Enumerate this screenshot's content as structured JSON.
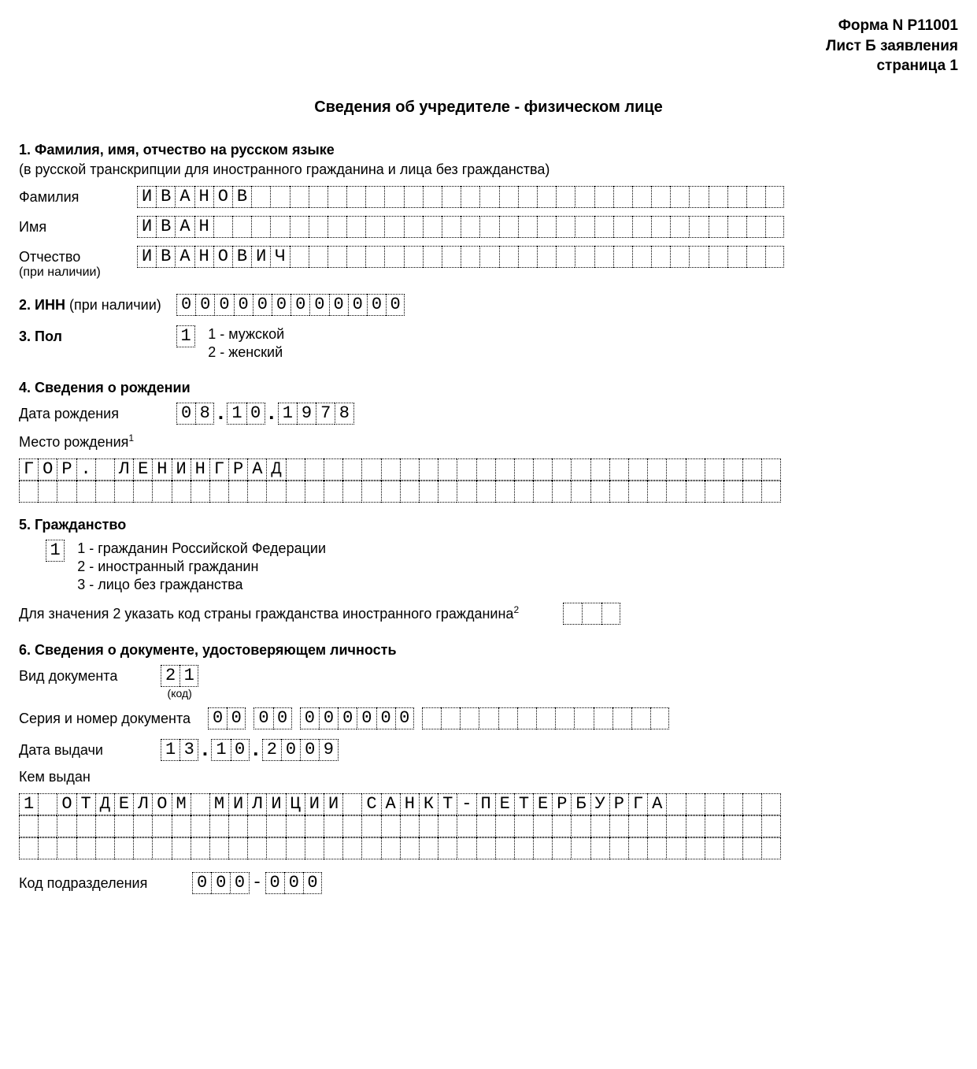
{
  "header": {
    "form": "Форма N Р11001",
    "sheet": "Лист Б заявления",
    "page": "страница 1"
  },
  "title": "Сведения об учредителе - физическом лице",
  "s1": {
    "head": "1. Фамилия, имя, отчество на русском языке",
    "note": "(в русской транскрипции для иностранного гражданина и лица без гражданства)",
    "surname_label": "Фамилия",
    "surname": "ИВАНОВ",
    "name_label": "Имя",
    "name": "ИВАН",
    "patr_label": "Отчество",
    "patr_sub": "(при наличии)",
    "patr": "ИВАНОВИЧ"
  },
  "s2": {
    "label_bold": "2. ИНН",
    "label_rest": " (при наличии)",
    "value": "000000000000"
  },
  "s3": {
    "label": "3. Пол",
    "value": "1",
    "opt1": "1 - мужской",
    "opt2": "2 - женский"
  },
  "s4": {
    "head": "4. Сведения о рождении",
    "dob_label": "Дата рождения",
    "dob_d": "08",
    "dob_m": "10",
    "dob_y": "1978",
    "pob_label": "Место рождения",
    "pob_sup": "1",
    "pob_line1": "ГОР. ЛЕНИНГРАД",
    "pob_line2": ""
  },
  "s5": {
    "head": "5. Гражданство",
    "value": "1",
    "opt1": "1 - гражданин Российской Федерации",
    "opt2": "2 - иностранный гражданин",
    "opt3": "3 - лицо без гражданства",
    "note": "Для значения 2 указать код страны гражданства иностранного гражданина",
    "note_sup": "2",
    "code": ""
  },
  "s6": {
    "head": "6. Сведения о документе, удостоверяющем личность",
    "doctype_label": "Вид документа",
    "doctype": "21",
    "doctype_sub": "(код)",
    "sernum_label": "Серия и номер документа",
    "ser1": "00",
    "ser2": "00",
    "num": "000000",
    "issue_label": "Дата выдачи",
    "issue_d": "13",
    "issue_m": "10",
    "issue_y": "2009",
    "issuer_label": "Кем выдан",
    "issuer1": "1 ОТДЕЛОМ МИЛИЦИИ САНКТ-ПЕТЕРБУРГА",
    "issuer2": "",
    "issuer3": "",
    "dept_label": "Код подразделения",
    "dept1": "000",
    "dept2": "000"
  }
}
